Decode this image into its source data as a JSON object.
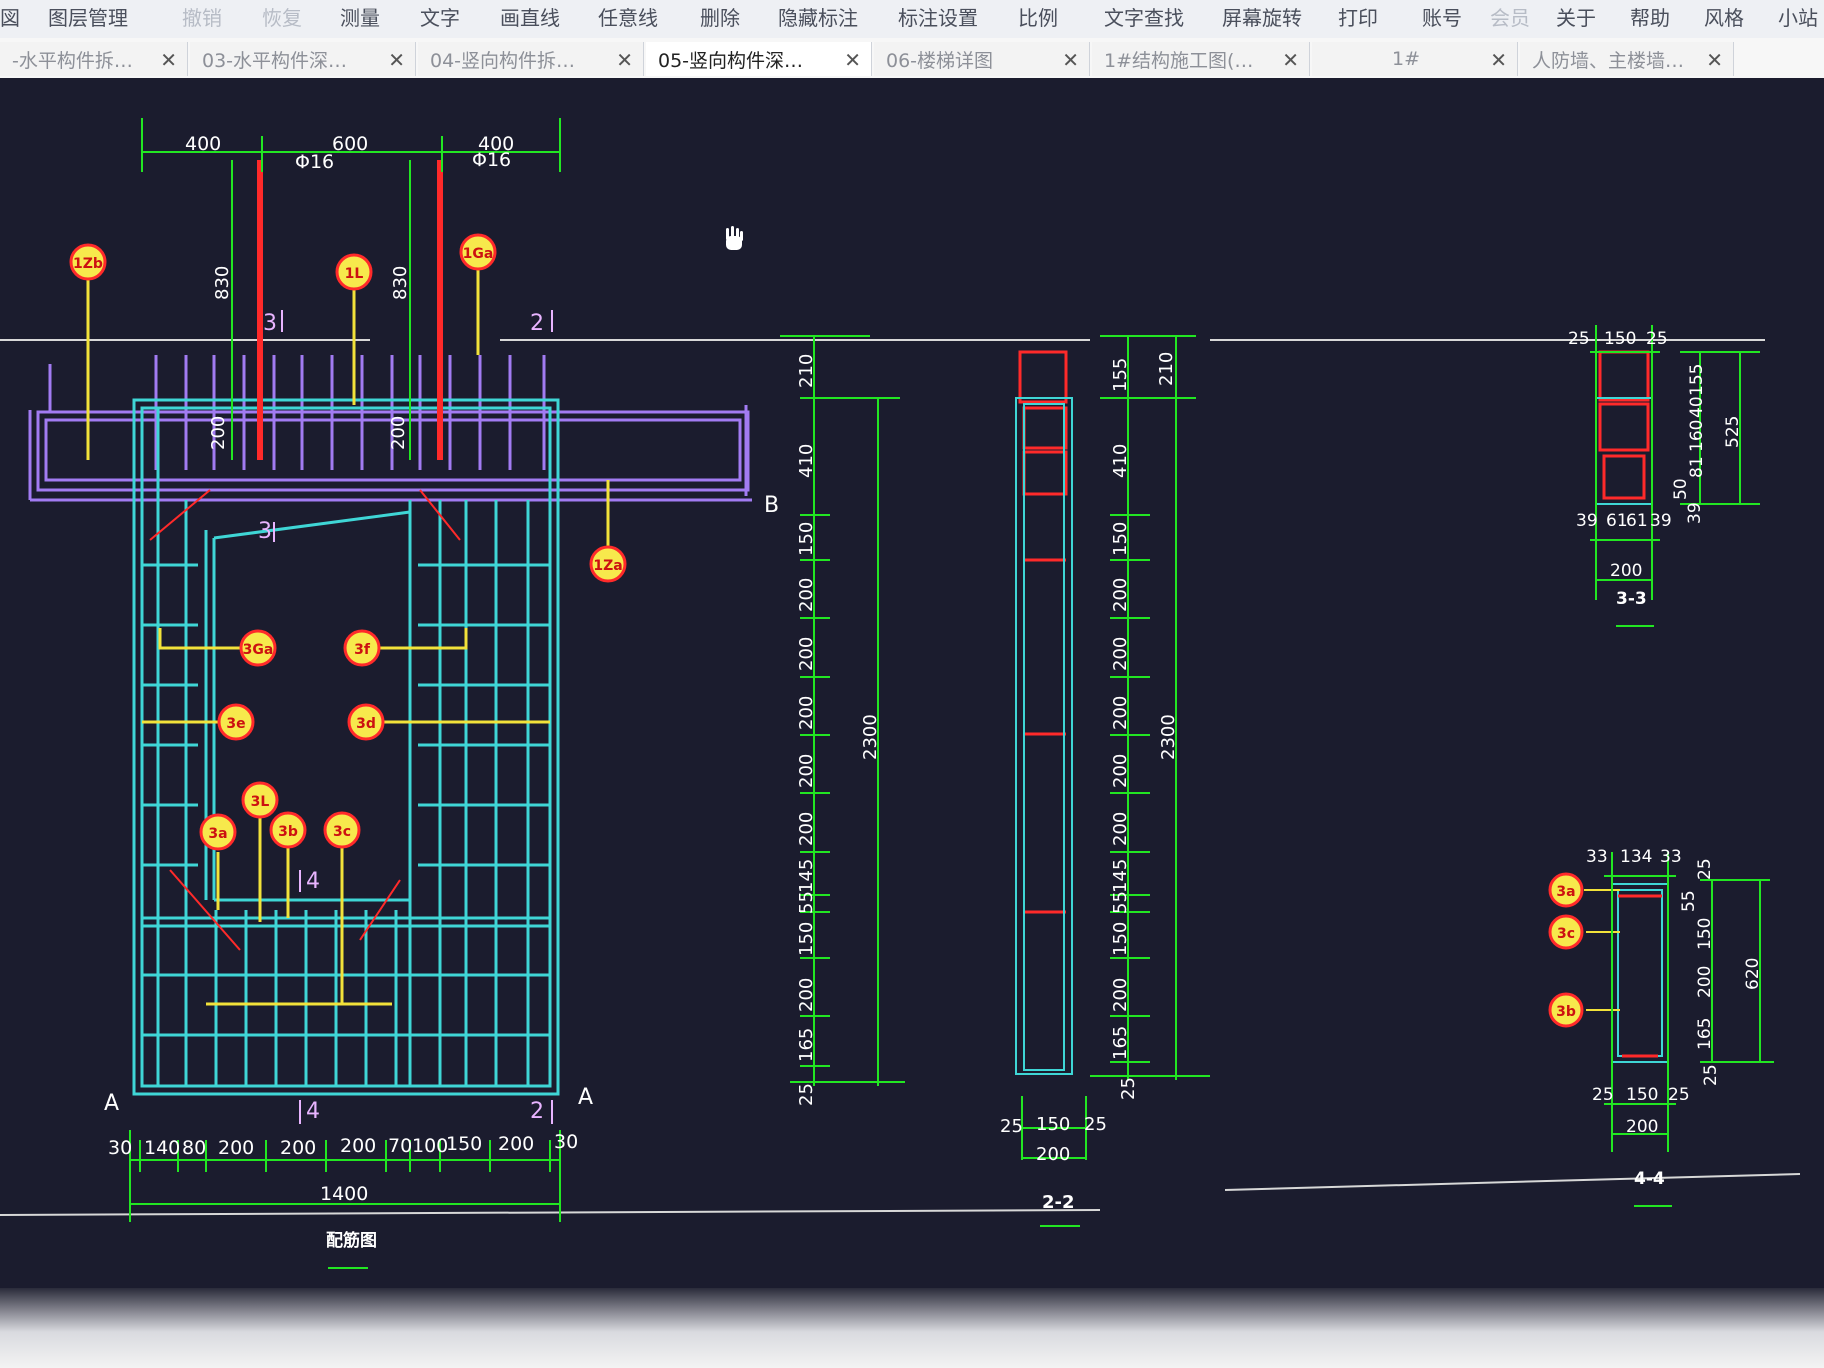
{
  "toolbar": {
    "items": [
      "図",
      "图层管理",
      "撤销",
      "恢复",
      "测量",
      "文字",
      "画直线",
      "任意线",
      "删除",
      "隐藏标注",
      "标注设置",
      "比例",
      "文字查找",
      "屏幕旋转",
      "打印",
      "账号",
      "会员",
      "关于",
      "帮助",
      "风格",
      "小站"
    ]
  },
  "tabs": [
    {
      "label": "-水平构件拆…"
    },
    {
      "label": "03-水平构件深…"
    },
    {
      "label": "04-竖向构件拆…"
    },
    {
      "label": "05-竖向构件深…"
    },
    {
      "label": "06-楼梯详图"
    },
    {
      "label": "1#结构施工图(…"
    },
    {
      "label": "1#"
    },
    {
      "label": "人防墙、主楼墙…"
    }
  ],
  "active_tab": 3,
  "colors": {
    "background": "#1b1c2e",
    "dimension": "#22e622",
    "rebar_cyan": "#3fd6d6",
    "rebar_purple": "#a27bf2",
    "rebar_red": "#ff2a2a",
    "leader_yellow": "#f2e23a",
    "tag_yellow": "#f7e94c"
  },
  "drawing": {
    "elevation": {
      "top_dims": [
        "400",
        "600",
        "400"
      ],
      "bar_labels": [
        "Φ16",
        "Φ16"
      ],
      "vertical_dims": [
        "830",
        "830",
        "200",
        "200"
      ],
      "section_marks": [
        "3",
        "2",
        "3",
        "4",
        "4",
        "2"
      ],
      "side_marks": [
        "B",
        "A",
        "A"
      ],
      "tags": [
        "1Zb",
        "1L",
        "1Ga",
        "1Za",
        "3Ga",
        "3f",
        "3e",
        "3d",
        "3L",
        "3a",
        "3b",
        "3c"
      ],
      "bottom_dims": [
        "30",
        "140",
        "80",
        "200",
        "200",
        "200",
        "70",
        "100",
        "150",
        "200",
        "30"
      ],
      "total_width": "1400",
      "caption": "配筋图"
    },
    "column_dims": [
      "210",
      "410",
      "150",
      "200",
      "200",
      "200",
      "200",
      "200",
      "145",
      "55",
      "150",
      "200",
      "165",
      "25"
    ],
    "column_total": "2300",
    "section_2_2": {
      "right_dims": [
        "155",
        "210",
        "410",
        "150",
        "200",
        "200",
        "200",
        "200",
        "200",
        "145",
        "55",
        "150",
        "200",
        "165",
        "25"
      ],
      "total": "2300",
      "bottom_dims": [
        "25",
        "150",
        "25"
      ],
      "width": "200",
      "title": "2-2"
    },
    "section_3_3": {
      "top_dims": [
        "25",
        "150",
        "25"
      ],
      "right_dims": [
        "155",
        "40",
        "160",
        "81",
        "50",
        "39"
      ],
      "total": "525",
      "bottom_dims": [
        "39",
        "61",
        "61",
        "39"
      ],
      "width": "200",
      "title": "3-3"
    },
    "section_4_4": {
      "top_dims": [
        "33",
        "134",
        "33"
      ],
      "right_dims": [
        "25",
        "55",
        "150",
        "200",
        "165",
        "25"
      ],
      "total": "620",
      "tags": [
        "3a",
        "3c",
        "3b"
      ],
      "bottom_dims": [
        "25",
        "150",
        "25"
      ],
      "width": "200",
      "title": "4-4"
    }
  }
}
